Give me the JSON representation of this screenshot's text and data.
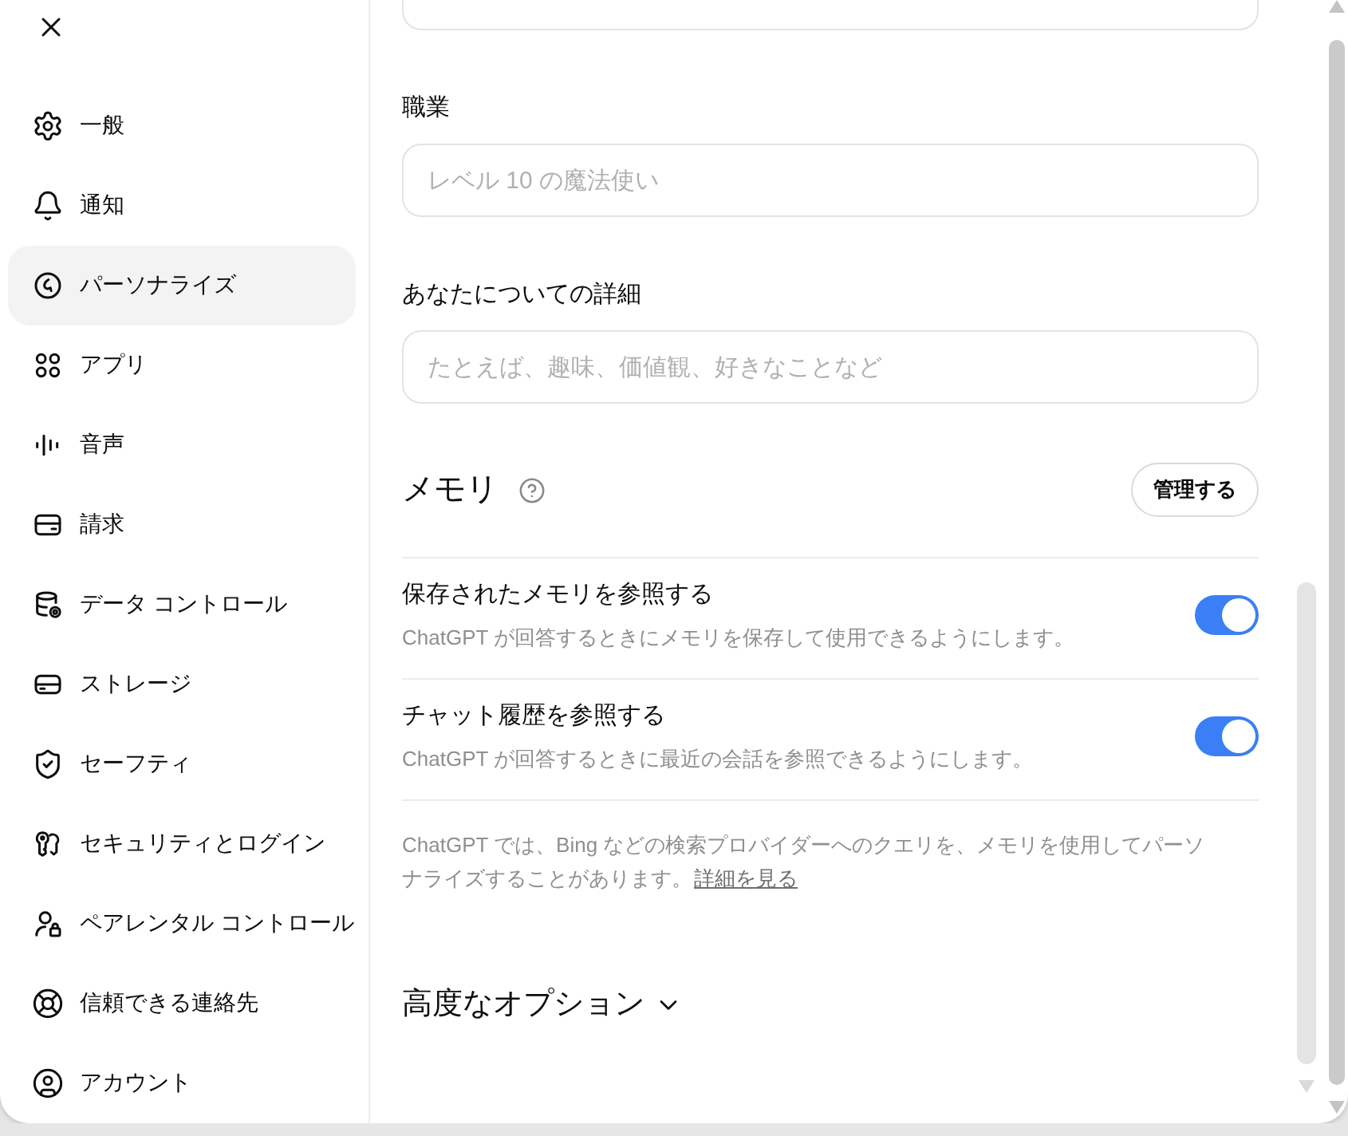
{
  "sidebar": {
    "items": [
      {
        "label": "一般",
        "selected": false
      },
      {
        "label": "通知",
        "selected": false
      },
      {
        "label": "パーソナライズ",
        "selected": true
      },
      {
        "label": "アプリ",
        "selected": false
      },
      {
        "label": "音声",
        "selected": false
      },
      {
        "label": "請求",
        "selected": false
      },
      {
        "label": "データ コントロール",
        "selected": false
      },
      {
        "label": "ストレージ",
        "selected": false
      },
      {
        "label": "セーフティ",
        "selected": false
      },
      {
        "label": "セキュリティとログイン",
        "selected": false
      },
      {
        "label": "ペアレンタル コントロール",
        "selected": false
      },
      {
        "label": "信頼できる連絡先",
        "selected": false
      },
      {
        "label": "アカウント",
        "selected": false
      }
    ]
  },
  "fields": [
    {
      "label": "職業",
      "placeholder": "レベル 10 の魔法使い"
    },
    {
      "label": "あなたについての詳細",
      "placeholder": "たとえば、趣味、価値観、好きなことなど"
    }
  ],
  "memory": {
    "title": "メモリ",
    "manage_button": "管理する",
    "settings": [
      {
        "title": "保存されたメモリを参照する",
        "description": "ChatGPT が回答するときにメモリを保存して使用できるようにします。",
        "on": true
      },
      {
        "title": "チャット履歴を参照する",
        "description": "ChatGPT が回答するときに最近の会話を参照できるようにします。",
        "on": true
      }
    ],
    "note": "ChatGPT では、Bing などの検索プロバイダーへのクエリを、メモリを使用してパーソナライズすることがあります。",
    "note_link": "詳細を見る"
  },
  "advanced_options": {
    "label": "高度なオプション",
    "expanded": false
  }
}
